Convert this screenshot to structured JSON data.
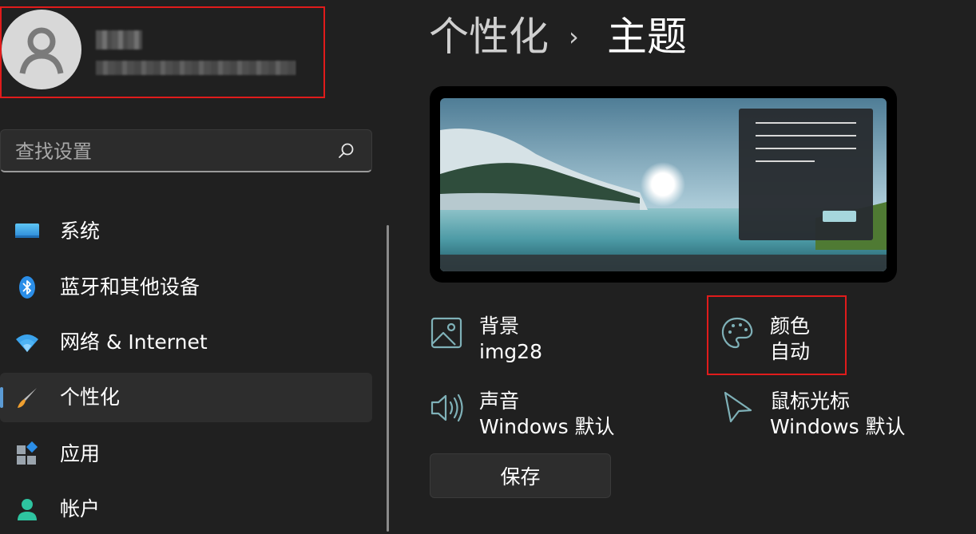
{
  "search": {
    "placeholder": "查找设置"
  },
  "sidebar": {
    "items": [
      {
        "label": "系统",
        "icon": "monitor-icon"
      },
      {
        "label": "蓝牙和其他设备",
        "icon": "bluetooth-icon"
      },
      {
        "label": "网络 & Internet",
        "icon": "wifi-icon"
      },
      {
        "label": "个性化",
        "icon": "brush-icon",
        "active": true
      },
      {
        "label": "应用",
        "icon": "apps-icon"
      },
      {
        "label": "帐户",
        "icon": "account-icon"
      }
    ]
  },
  "breadcrumb": {
    "parent": "个性化",
    "separator": "›",
    "current": "主题"
  },
  "options": {
    "background": {
      "title": "背景",
      "value": "img28",
      "icon": "image-icon"
    },
    "color": {
      "title": "颜色",
      "value": "自动",
      "icon": "palette-icon"
    },
    "sound": {
      "title": "声音",
      "value": "Windows 默认",
      "icon": "speaker-icon"
    },
    "cursor": {
      "title": "鼠标光标",
      "value": "Windows 默认",
      "icon": "cursor-icon"
    }
  },
  "save_button": {
    "label": "保存"
  },
  "colors": {
    "accent": "#5b9bd5",
    "highlight_border": "#e01b1b",
    "background": "#202020"
  }
}
